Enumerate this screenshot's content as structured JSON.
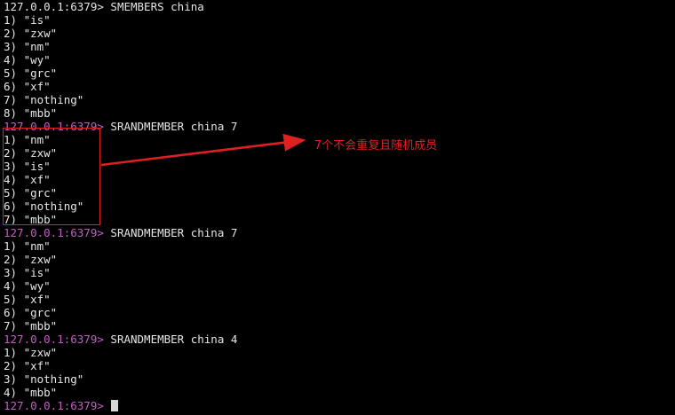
{
  "terminal": {
    "lines": [
      {
        "kind": "prompt",
        "host": "127.0.0.1:6379>",
        "cmd": " SMEMBERS china"
      },
      {
        "kind": "out",
        "text": "1) \"is\""
      },
      {
        "kind": "out",
        "text": "2) \"zxw\""
      },
      {
        "kind": "out",
        "text": "3) \"nm\""
      },
      {
        "kind": "out",
        "text": "4) \"wy\""
      },
      {
        "kind": "out",
        "text": "5) \"grc\""
      },
      {
        "kind": "out",
        "text": "6) \"xf\""
      },
      {
        "kind": "out",
        "text": "7) \"nothing\""
      },
      {
        "kind": "out",
        "text": "8) \"mbb\""
      },
      {
        "kind": "prompt",
        "host": "127.0.0.1:6379>",
        "cmd": " SRANDMEMBER china 7",
        "magenta": true
      },
      {
        "kind": "out",
        "text": "1) \"nm\""
      },
      {
        "kind": "out",
        "text": "2) \"zxw\""
      },
      {
        "kind": "out",
        "text": "3) \"is\""
      },
      {
        "kind": "out",
        "text": "4) \"xf\""
      },
      {
        "kind": "out",
        "text": "5) \"grc\""
      },
      {
        "kind": "out",
        "text": "6) \"nothing\""
      },
      {
        "kind": "out",
        "text": "7) \"mbb\""
      },
      {
        "kind": "prompt",
        "host": "127.0.0.1:6379>",
        "cmd": " SRANDMEMBER china 7",
        "magenta": true
      },
      {
        "kind": "out",
        "text": "1) \"nm\""
      },
      {
        "kind": "out",
        "text": "2) \"zxw\""
      },
      {
        "kind": "out",
        "text": "3) \"is\""
      },
      {
        "kind": "out",
        "text": "4) \"wy\""
      },
      {
        "kind": "out",
        "text": "5) \"xf\""
      },
      {
        "kind": "out",
        "text": "6) \"grc\""
      },
      {
        "kind": "out",
        "text": "7) \"mbb\""
      },
      {
        "kind": "prompt",
        "host": "127.0.0.1:6379>",
        "cmd": " SRANDMEMBER china 4",
        "magenta": true
      },
      {
        "kind": "out",
        "text": "1) \"zxw\""
      },
      {
        "kind": "out",
        "text": "2) \"xf\""
      },
      {
        "kind": "out",
        "text": "3) \"nothing\""
      },
      {
        "kind": "out",
        "text": "4) \"mbb\""
      },
      {
        "kind": "prompt",
        "host": "127.0.0.1:6379>",
        "cmd": " ",
        "magenta": true,
        "cursor": true
      }
    ]
  },
  "annotation": {
    "text": "7个不会重复且随机成员",
    "color": "#e02020"
  },
  "colors": {
    "background": "#000000",
    "text": "#e6e6e6",
    "prompt_magenta": "#c25ec2",
    "annotation_red": "#e02020"
  }
}
